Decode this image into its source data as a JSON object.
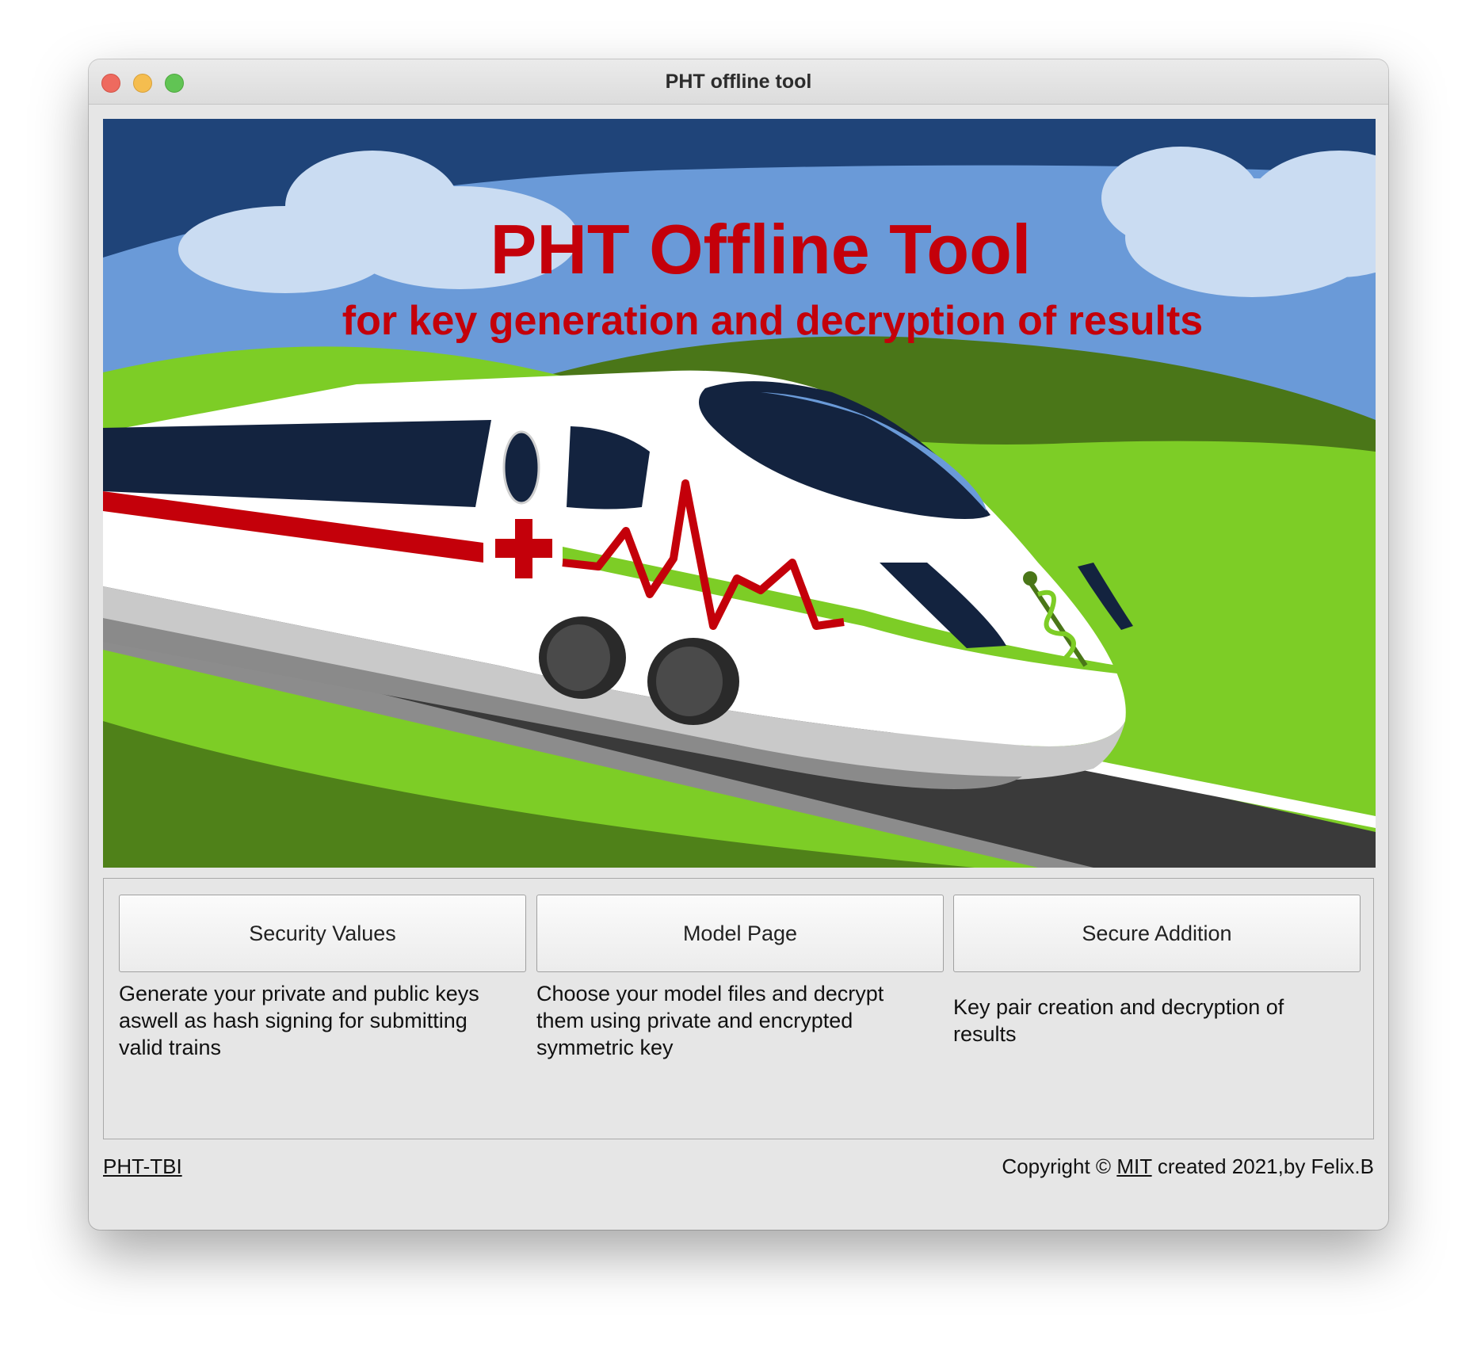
{
  "window": {
    "title": "PHT offline tool"
  },
  "banner": {
    "title": "PHT Offline Tool",
    "subtitle": "for key generation and decryption of results"
  },
  "actions": [
    {
      "label": "Security Values",
      "description_lines": [
        "Generate your private and public keys",
        "aswell as hash signing for submitting",
        "valid trains"
      ]
    },
    {
      "label": "Model Page",
      "description_lines": [
        "Choose your model files and decrypt",
        "them using private and encrypted",
        "symmetric key"
      ]
    },
    {
      "label": "Secure Addition",
      "description_lines": [
        "Key pair creation and decryption of",
        "results"
      ]
    }
  ],
  "footer": {
    "left_link": "PHT-TBI",
    "copyright_prefix": "Copyright ©",
    "license_link": "MIT",
    "copyright_suffix": "created 2021,by Felix.B"
  },
  "colors": {
    "sky_dark": "#1f4479",
    "sky_light": "#6a9ad8",
    "cloud": "#cadcf2",
    "grass": "#7dcd26",
    "grass_dark": "#4a7618",
    "title_red": "#c4000a",
    "train_window": "#13233f",
    "window_bg": "#e6e6e6"
  }
}
